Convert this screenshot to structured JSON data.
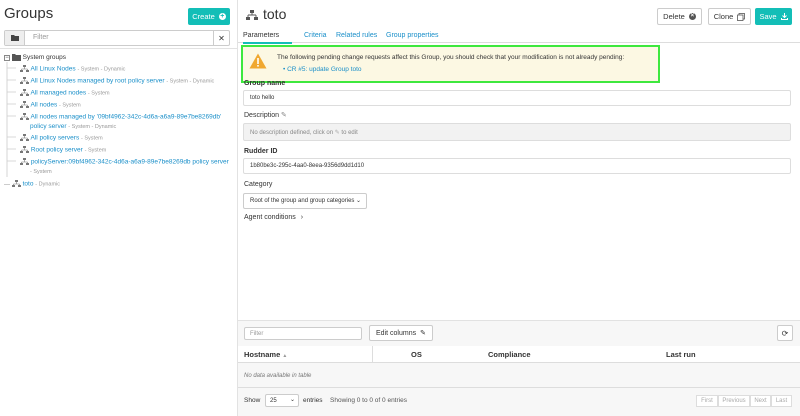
{
  "sidebar": {
    "title": "Groups",
    "create_label": "Create",
    "filter_placeholder": "Filter",
    "tree": [
      {
        "label": "System groups",
        "meta": ""
      },
      {
        "label": "All Linux Nodes",
        "meta": "- System - Dynamic"
      },
      {
        "label": "All Linux Nodes managed by root policy server",
        "meta": "- System - Dynamic"
      },
      {
        "label": "All managed nodes",
        "meta": "- System"
      },
      {
        "label": "All nodes",
        "meta": "- System"
      },
      {
        "label": "All nodes managed by '09bf4962-342c-4d6a-a6a9-89e7be8269db'",
        "label2": "policy server",
        "meta": "- System - Dynamic"
      },
      {
        "label": "All policy servers",
        "meta": "- System"
      },
      {
        "label": "Root policy server",
        "meta": "- System"
      },
      {
        "label": "policyServer:09bf4962-342c-4d6a-a6a9-89e7be8269db policy server",
        "meta": "- System"
      },
      {
        "label": "toto",
        "meta": "- Dynamic"
      }
    ]
  },
  "header": {
    "title": "toto",
    "delete_label": "Delete",
    "clone_label": "Clone",
    "save_label": "Save"
  },
  "tabs": [
    {
      "label": "Parameters"
    },
    {
      "label": "Criteria"
    },
    {
      "label": "Related rules"
    },
    {
      "label": "Group properties"
    }
  ],
  "warning": {
    "text": "The following pending change requests affect this Group, you should check that your modification is not already pending:",
    "link": "CR #5: update Group toto"
  },
  "form": {
    "group_name_label": "Group name",
    "group_name_value": "toto hello",
    "description_label": "Description",
    "description_prefix": "No description defined, click on",
    "description_suffix": "to edit",
    "rudder_id_label": "Rudder ID",
    "rudder_id_value": "1b80be3c-295c-4aa0-8eea-9356d9dd1d10",
    "category_label": "Category",
    "category_value": "Root of the group and group categories",
    "agent_conditions_label": "Agent conditions"
  },
  "nodes_table": {
    "filter_placeholder": "Filter",
    "edit_columns_label": "Edit columns",
    "columns": [
      "Hostname",
      "OS",
      "Compliance",
      "Last run"
    ],
    "empty_text": "No data available in table",
    "show_label": "Show",
    "page_size": "25",
    "entries_label": "entries",
    "info": "Showing 0 to 0 of 0 entries",
    "pagination": [
      "First",
      "Previous",
      "Next",
      "Last"
    ]
  }
}
